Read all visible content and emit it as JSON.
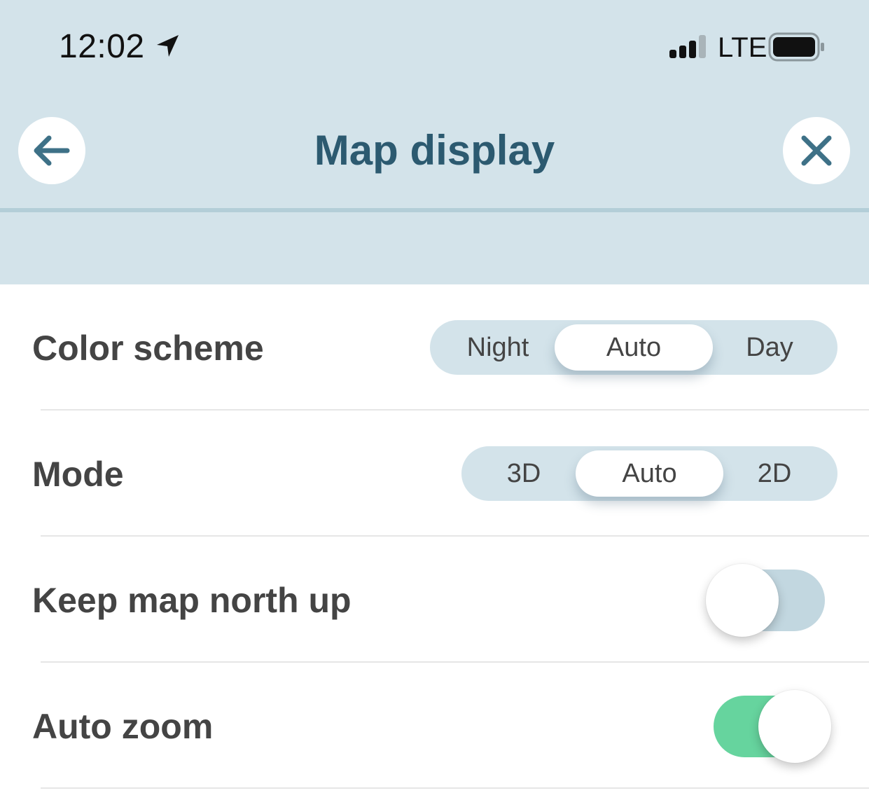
{
  "status_bar": {
    "time": "12:02",
    "network": "LTE",
    "icons": [
      "location-arrow-icon",
      "signal-bars-icon",
      "battery-icon"
    ]
  },
  "header": {
    "title": "Map display",
    "back_icon": "arrow-left-icon",
    "close_icon": "close-icon"
  },
  "settings": {
    "color_scheme": {
      "label": "Color scheme",
      "options": [
        "Night",
        "Auto",
        "Day"
      ],
      "selected": "Auto"
    },
    "mode": {
      "label": "Mode",
      "options": [
        "3D",
        "Auto",
        "2D"
      ],
      "selected": "Auto"
    },
    "north_up": {
      "label": "Keep map north up",
      "on": false
    },
    "auto_zoom": {
      "label": "Auto zoom",
      "on": true
    }
  },
  "colors": {
    "header_bg": "#d3e3ea",
    "accent": "#2c5a70",
    "toggle_on": "#66d49e",
    "toggle_off": "#c2d7e0"
  }
}
